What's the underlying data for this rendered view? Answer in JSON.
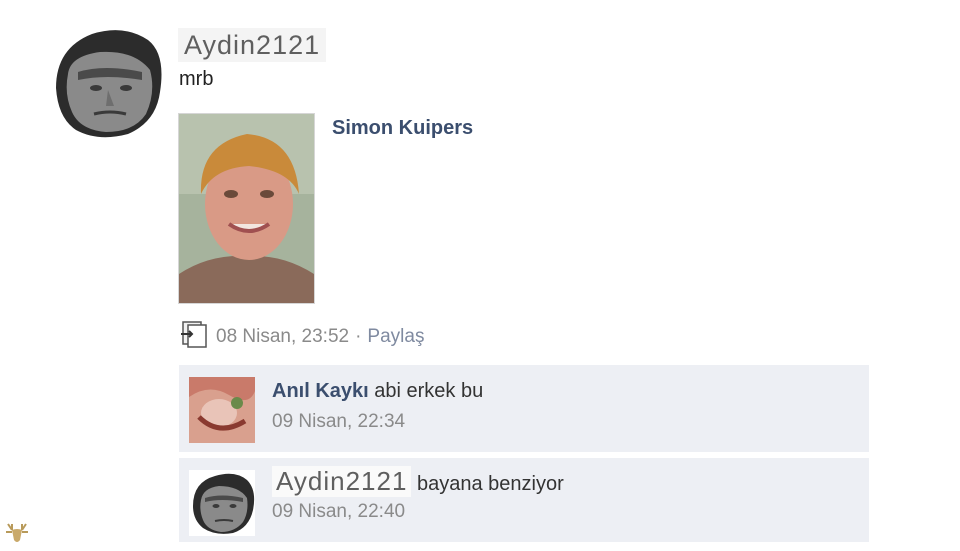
{
  "post": {
    "author": "Aydin2121",
    "text": "mrb",
    "attachment": {
      "name": "Simon Kuipers"
    },
    "timestamp": "08 Nisan, 23:52",
    "separator": "·",
    "share_label": "Paylaş"
  },
  "comments": [
    {
      "author": "Anıl Kaykı",
      "text": "abi erkek bu",
      "timestamp": "09 Nisan, 22:34"
    },
    {
      "author": "Aydin2121",
      "text": "bayana benziyor",
      "timestamp": "09 Nisan, 22:40"
    }
  ],
  "icons": {
    "post_type": "page-share-icon",
    "watermark": "deer-logo-icon"
  },
  "colors": {
    "link": "#3b4e6e",
    "comment_bg": "#edeff4",
    "meta": "#8a8a8a"
  }
}
